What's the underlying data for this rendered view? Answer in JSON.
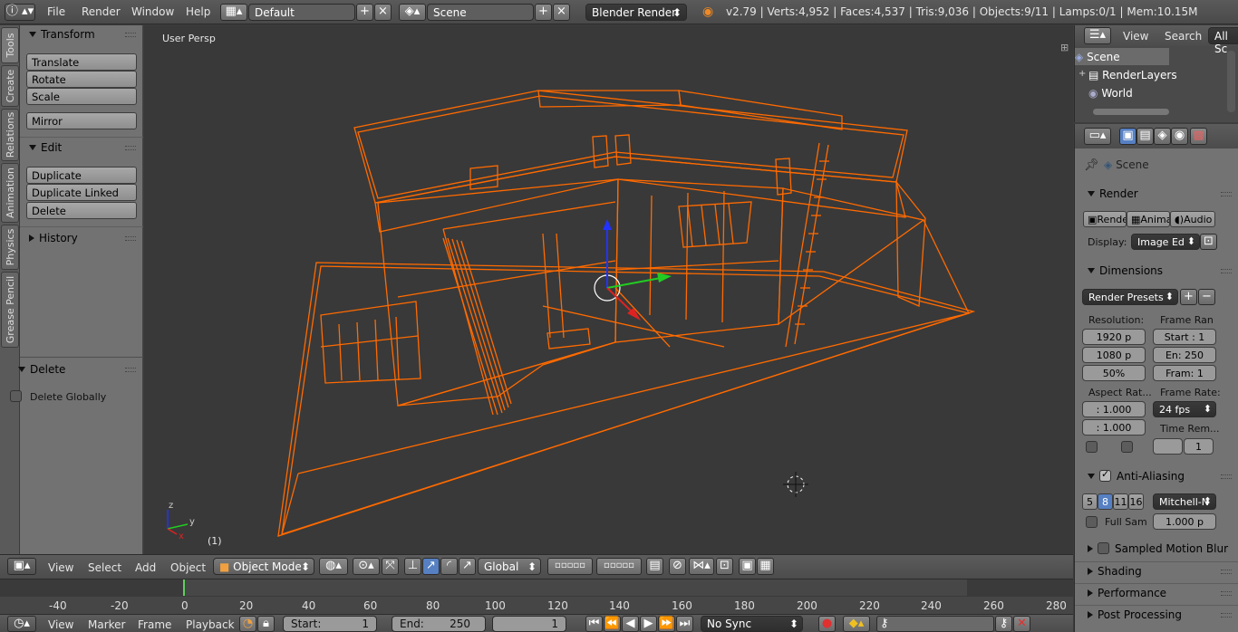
{
  "topbar": {
    "menus": [
      "File",
      "Render",
      "Window",
      "Help"
    ],
    "screen_layout": "Default",
    "scene": "Scene",
    "engine": "Blender Render",
    "stats": "v2.79 | Verts:4,952 | Faces:4,537 | Tris:9,036 | Objects:9/11 | Lamps:0/1 | Mem:10.15M"
  },
  "toolshelf": {
    "tabs": [
      "Tools",
      "Create",
      "Relations",
      "Animation",
      "Physics",
      "Grease Pencil"
    ],
    "transform": {
      "title": "Transform",
      "buttons": [
        "Translate",
        "Rotate",
        "Scale",
        "Mirror"
      ]
    },
    "edit": {
      "title": "Edit",
      "buttons": [
        "Duplicate",
        "Duplicate Linked",
        "Delete"
      ]
    },
    "history": {
      "title": "History"
    },
    "operator": {
      "title": "Delete",
      "option": "Delete Globally"
    }
  },
  "viewport": {
    "view_label": "User Persp",
    "frame_label": "(1)",
    "wire_color": "#ff6a00",
    "axis_labels": [
      "z",
      "y",
      "x"
    ]
  },
  "view3d_header": {
    "menus": [
      "View",
      "Select",
      "Add",
      "Object"
    ],
    "mode": "Object Mode",
    "orientation": "Global"
  },
  "timeline": {
    "ticks": [
      "-40",
      "-20",
      "0",
      "20",
      "40",
      "60",
      "80",
      "100",
      "120",
      "140",
      "160",
      "180",
      "200",
      "220",
      "240",
      "260",
      "280"
    ],
    "menus": [
      "View",
      "Marker",
      "Frame",
      "Playback"
    ],
    "start_label": "Start:",
    "start_value": "1",
    "end_label": "End:",
    "end_value": "250",
    "current_frame": "1",
    "sync": "No Sync"
  },
  "outliner": {
    "menus": [
      "View",
      "Search"
    ],
    "filter": "All Sc",
    "items": [
      "Scene",
      "RenderLayers",
      "World"
    ]
  },
  "properties": {
    "context": "Scene",
    "render": {
      "title": "Render",
      "buttons": [
        "Rende",
        "Anima",
        "Audio"
      ],
      "display_label": "Display:",
      "display_value": "Image Ed"
    },
    "dimensions": {
      "title": "Dimensions",
      "presets": "Render Presets",
      "resolution_label": "Resolution:",
      "res_x": "1920 p",
      "res_y": "1080 p",
      "res_pct": "50%",
      "frame_range_label": "Frame Ran",
      "start": "Start : 1",
      "end": "En: 250",
      "step": "Fram: 1",
      "aspect_label": "Aspect Rat...",
      "aspect_x": ": 1.000",
      "aspect_y": ": 1.000",
      "frame_rate_label": "Frame Rate:",
      "fps": "24 fps",
      "time_remap_label": "Time Rem...",
      "time_remap_value": "1"
    },
    "anti_aliasing": {
      "title": "Anti-Aliasing",
      "samples": [
        "5",
        "8",
        "11",
        "16"
      ],
      "filter": "Mitchell-N",
      "full_sample": "Full Sam",
      "filter_size": "1.000 p"
    },
    "collapsed_panels": [
      "Sampled Motion Blur",
      "Shading",
      "Performance",
      "Post Processing"
    ]
  }
}
